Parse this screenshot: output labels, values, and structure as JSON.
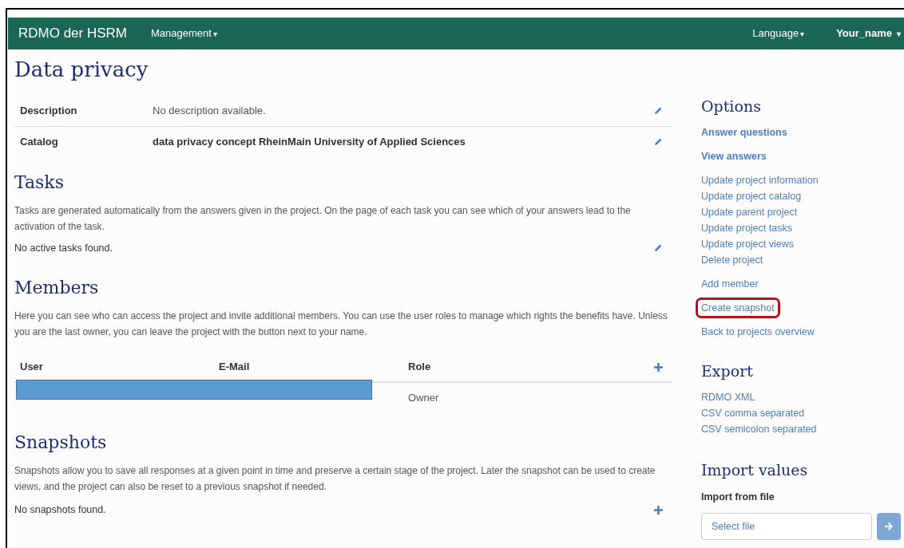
{
  "navbar": {
    "brand": "RDMO der HSRM",
    "left_menus": [
      {
        "label": "Management",
        "caret": "▾"
      }
    ],
    "right_menus": [
      {
        "label": "Language",
        "caret": "▾"
      },
      {
        "label": "Your_name",
        "caret": "▾"
      }
    ]
  },
  "title": "Data privacy",
  "info": [
    {
      "label": "Description",
      "value": "No description available.",
      "kind": "plain"
    },
    {
      "label": "Catalog",
      "value": "data privacy concept RheinMain University of Applied Sciences",
      "kind": "strong"
    }
  ],
  "tasks": {
    "heading": "Tasks",
    "text": "Tasks are generated automatically from the answers given in the project. On the page of each task you can see which of your answers lead to the activation of the task.",
    "empty": "No active tasks found."
  },
  "members": {
    "heading": "Members",
    "text": "Here you can see who can access the project and invite additional members. You can use the user roles to manage which rights the benefits have. Unless you are the last owner, you can leave the project with the button next to your name.",
    "columns": [
      "User",
      "E-Mail",
      "Role"
    ],
    "rows": [
      {
        "role": "Owner",
        "redacted": true
      }
    ]
  },
  "snapshots": {
    "heading": "Snapshots",
    "text": "Snapshots allow you to save all responses at a given point in time and preserve a certain stage of the project. Later the snapshot can be used to create views, and the project can also be reset to a previous snapshot if needed.",
    "empty": "No snapshots found."
  },
  "options": {
    "heading": "Options",
    "groups": [
      [
        {
          "label": "Answer questions",
          "kind": "primary",
          "highlighted": false
        }
      ],
      [
        {
          "label": "View answers",
          "kind": "primary",
          "highlighted": false
        }
      ],
      [
        {
          "label": "Update project information",
          "kind": "link",
          "highlighted": false
        },
        {
          "label": "Update project catalog",
          "kind": "link",
          "highlighted": false
        },
        {
          "label": "Update parent project",
          "kind": "link",
          "highlighted": false
        },
        {
          "label": "Update project tasks",
          "kind": "link",
          "highlighted": false
        },
        {
          "label": "Update project views",
          "kind": "link",
          "highlighted": false
        },
        {
          "label": "Delete project",
          "kind": "link",
          "highlighted": false
        }
      ],
      [
        {
          "label": "Add member",
          "kind": "link",
          "highlighted": false
        }
      ],
      [
        {
          "label": "Create snapshot",
          "kind": "link",
          "highlighted": true
        }
      ],
      [
        {
          "label": "Back to projects overview",
          "kind": "link",
          "highlighted": false
        }
      ]
    ]
  },
  "export": {
    "heading": "Export",
    "links": [
      "RDMO XML",
      "CSV comma separated",
      "CSV semicolon separated"
    ]
  },
  "import": {
    "heading": "Import values",
    "label": "Import from file",
    "placeholder": "Select file"
  }
}
